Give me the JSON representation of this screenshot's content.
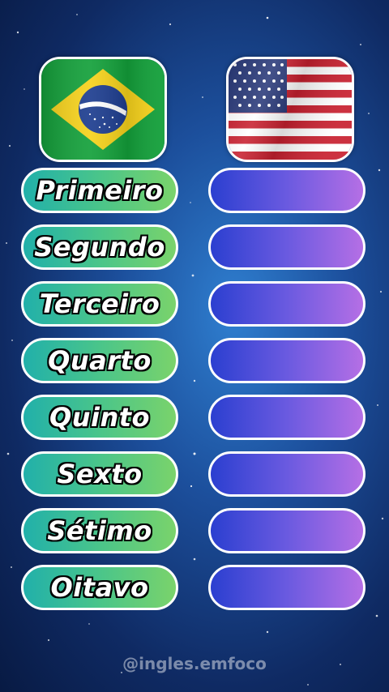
{
  "flags": {
    "left": {
      "icon": "brazil-flag-icon",
      "banner_text": "ORDEM E PROGRESSO"
    },
    "right": {
      "icon": "usa-flag-icon"
    }
  },
  "portuguese_words": [
    "Primeiro",
    "Segundo",
    "Terceiro",
    "Quarto",
    "Quinto",
    "Sexto",
    "Sétimo",
    "Oitavo"
  ],
  "watermark": "@ingles.emfoco",
  "colors": {
    "left_pill_gradient": [
      "#21b0aa",
      "#7ad36b"
    ],
    "right_pill_gradient": [
      "#2b3fd0",
      "#b56fe5"
    ],
    "background": "#1c4f9c"
  }
}
